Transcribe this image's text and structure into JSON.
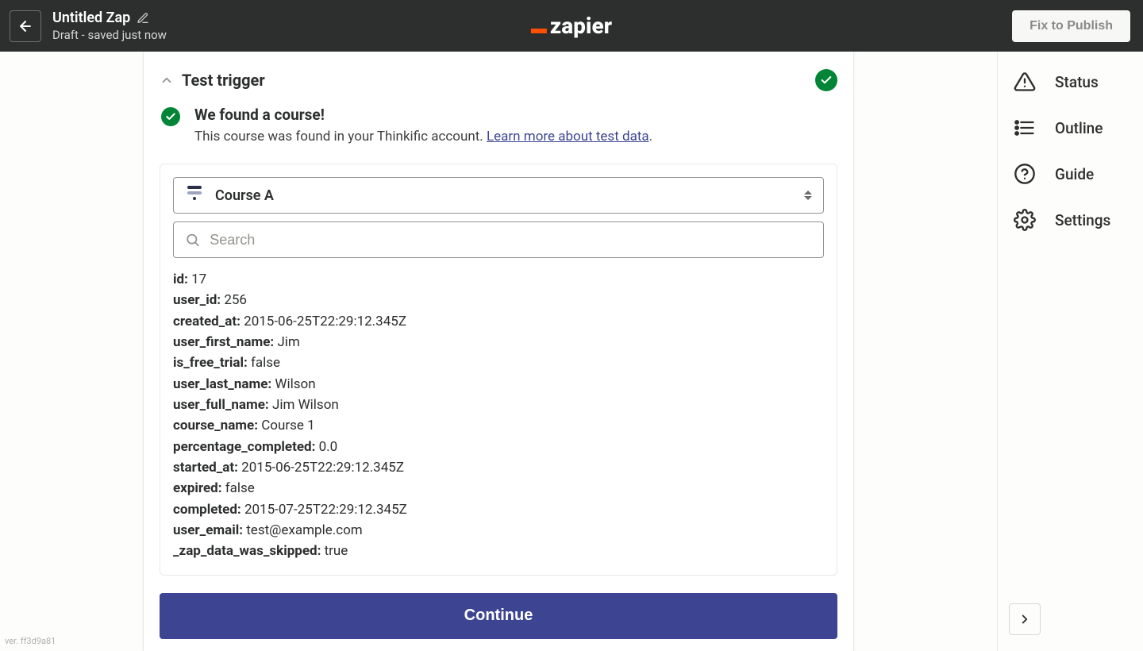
{
  "header": {
    "title": "Untitled Zap",
    "status": "Draft - saved just now",
    "brand": "zapier",
    "publish_label": "Fix to Publish"
  },
  "rail": {
    "items": [
      {
        "label": "Status"
      },
      {
        "label": "Outline"
      },
      {
        "label": "Guide"
      },
      {
        "label": "Settings"
      }
    ]
  },
  "panel": {
    "section_title": "Test trigger",
    "found_title": "We found a course!",
    "found_desc": "This course was found in your Thinkific account. ",
    "found_link": "Learn more about test data",
    "found_tail": ".",
    "selector_label": "Course A",
    "search_placeholder": "Search",
    "continue_label": "Continue",
    "fields": [
      {
        "key": "id",
        "value": "17"
      },
      {
        "key": "user_id",
        "value": "256"
      },
      {
        "key": "created_at",
        "value": "2015-06-25T22:29:12.345Z"
      },
      {
        "key": "user_first_name",
        "value": "Jim"
      },
      {
        "key": "is_free_trial",
        "value": "false"
      },
      {
        "key": "user_last_name",
        "value": "Wilson"
      },
      {
        "key": "user_full_name",
        "value": "Jim Wilson"
      },
      {
        "key": "course_name",
        "value": "Course 1"
      },
      {
        "key": "percentage_completed",
        "value": "0.0"
      },
      {
        "key": "started_at",
        "value": "2015-06-25T22:29:12.345Z"
      },
      {
        "key": "expired",
        "value": "false"
      },
      {
        "key": "completed",
        "value": "2015-07-25T22:29:12.345Z"
      },
      {
        "key": "user_email",
        "value": "test@example.com"
      },
      {
        "key": "_zap_data_was_skipped",
        "value": "true"
      }
    ]
  },
  "footer": {
    "version": "ver. ff3d9a81"
  },
  "colors": {
    "accent": "#3d4592",
    "success": "#038537",
    "orange": "#ff4f00"
  }
}
